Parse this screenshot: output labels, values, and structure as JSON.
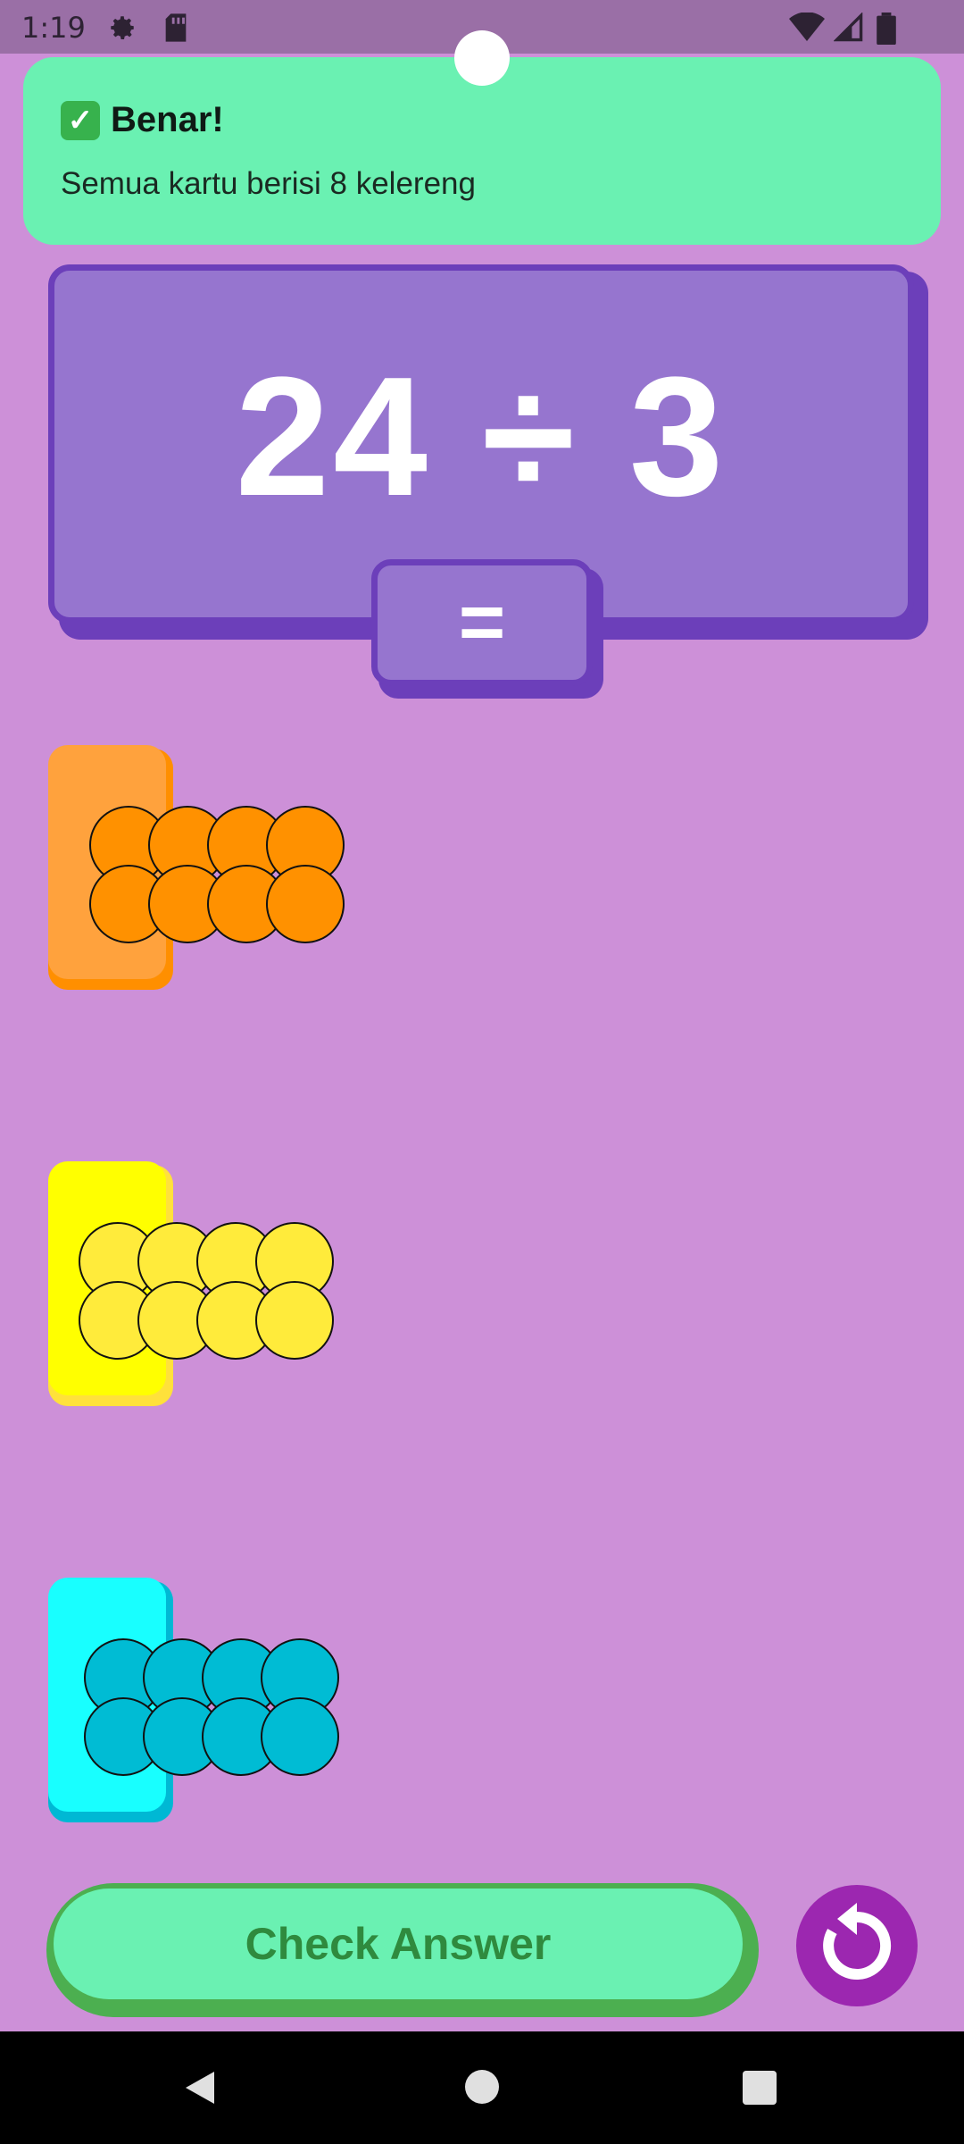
{
  "status": {
    "time": "1:19"
  },
  "toast": {
    "title": "Benar!",
    "message": "Semua kartu berisi 8 kelereng"
  },
  "equation": {
    "text": "24 ÷ 3",
    "equals": "="
  },
  "cards": [
    {
      "name": "orange",
      "color": "#ffa23d",
      "shadow": "#ff8f00",
      "marble": "#ff9100",
      "marbles": 8
    },
    {
      "name": "yellow",
      "color": "#ffff00",
      "shadow": "#ffe13b",
      "marble": "#ffeb3b",
      "marbles": 8
    },
    {
      "name": "cyan",
      "color": "#18ffff",
      "shadow": "#00b8d4",
      "marble": "#00bcd4",
      "marbles": 8
    }
  ],
  "actions": {
    "check_label": "Check Answer",
    "reset_icon": "refresh-icon"
  },
  "icons": [
    "gear-icon",
    "sd-card-icon",
    "wifi-icon",
    "signal-icon",
    "battery-icon",
    "back-icon",
    "home-icon",
    "recents-icon"
  ]
}
